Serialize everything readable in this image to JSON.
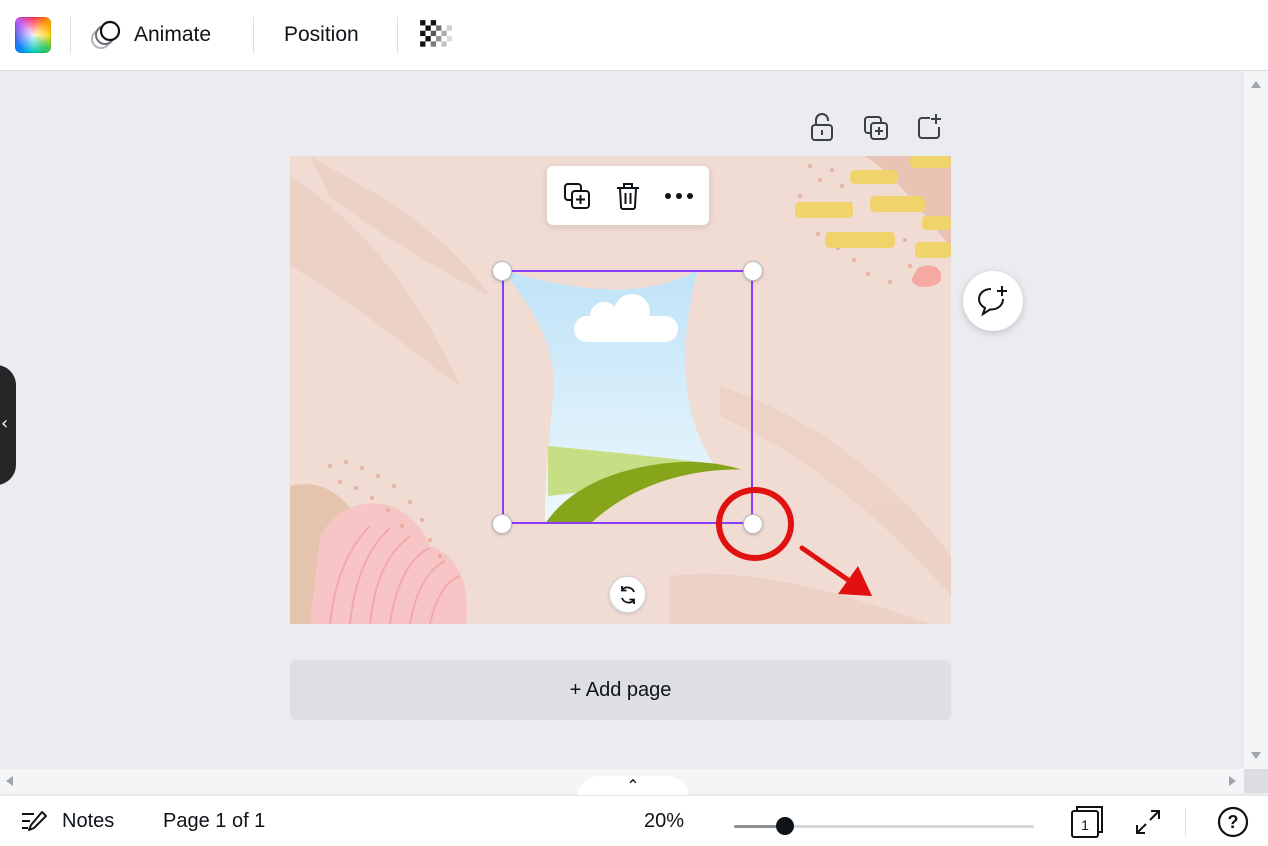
{
  "toolbar": {
    "animate_label": "Animate",
    "position_label": "Position",
    "icons": [
      "color-swatch-icon",
      "animate-icon",
      "transparency-icon"
    ]
  },
  "page_actions": {
    "icons": [
      "unlock-icon",
      "duplicate-page-icon",
      "add-page-icon"
    ]
  },
  "element_toolbar": {
    "icons": [
      "copy-icon",
      "trash-icon",
      "more-icon"
    ]
  },
  "canvas": {
    "background_color": "#f0dcd3",
    "selection_color": "#8b3dff",
    "annotation_color": "#e11111"
  },
  "add_page_label": "+ Add page",
  "bottom_bar": {
    "notes_label": "Notes",
    "page_indicator": "Page 1 of 1",
    "zoom_label": "20%",
    "zoom_fraction": 0.17,
    "page_count": "1",
    "help_label": "?"
  }
}
